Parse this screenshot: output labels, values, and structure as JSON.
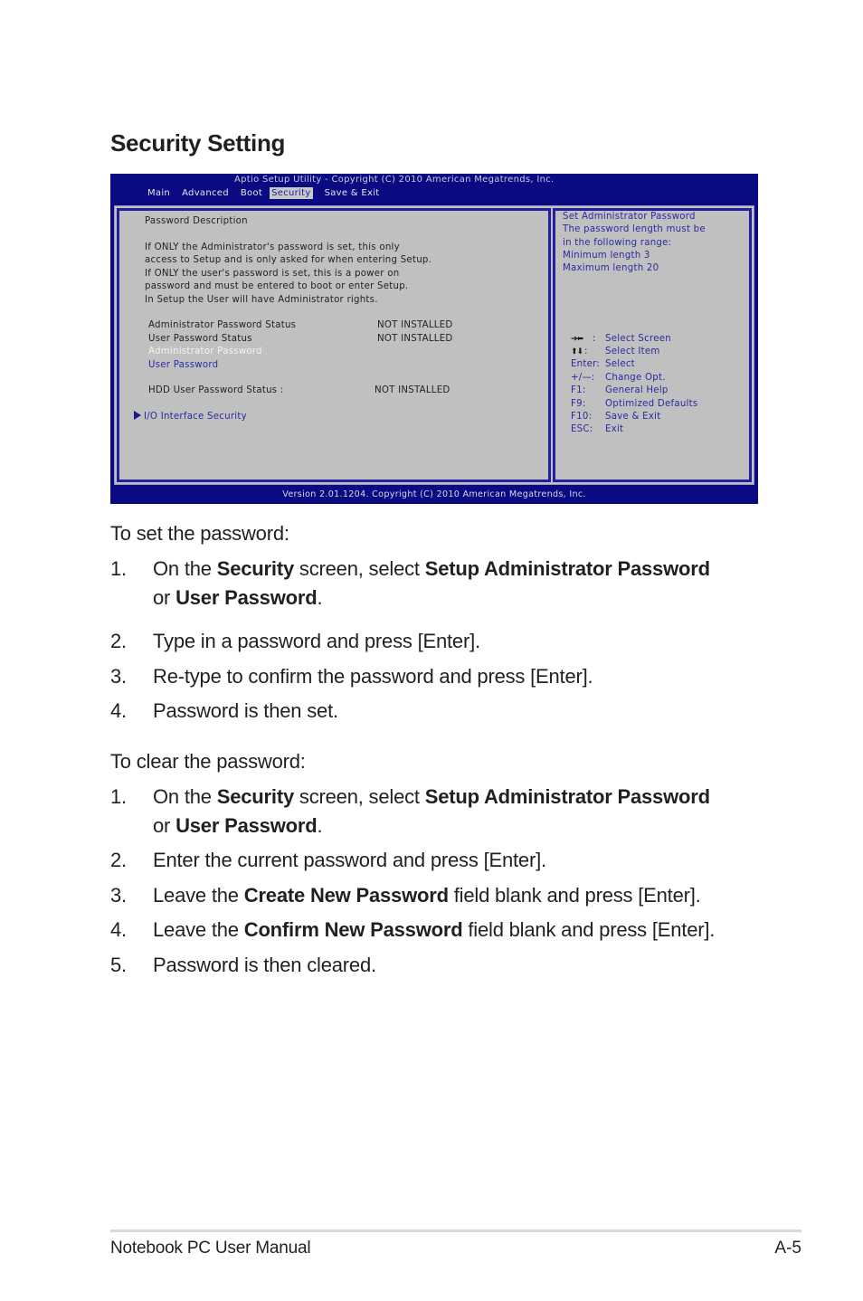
{
  "section_title": "Security Setting",
  "bios": {
    "title": "Aptio Setup Utility - Copyright (C) 2010 American Megatrends, Inc.",
    "tabs": [
      {
        "label": "Main",
        "active": false
      },
      {
        "label": "Advanced",
        "active": false
      },
      {
        "label": "Boot",
        "active": false
      },
      {
        "label": "Security",
        "active": true
      },
      {
        "label": "Save & Exit",
        "active": false
      }
    ],
    "description_heading": "Password Description",
    "description_lines": [
      "If ONLY the Administrator's password is set, this only",
      "access to Setup and is only asked for when entering Setup.",
      "If ONLY the user's password is set, this is a power on",
      "password and must be entered to boot or enter Setup.",
      "In Setup the User will have Administrator rights."
    ],
    "status_rows": [
      {
        "label": "Administrator Password Status",
        "value": "NOT INSTALLED"
      },
      {
        "label": "User Password Status",
        "value": "NOT INSTALLED"
      }
    ],
    "menu_items": [
      {
        "label": "Administrator Password",
        "selected": true
      },
      {
        "label": "User Password",
        "selected": false
      }
    ],
    "hdd_status": {
      "label": "HDD User Password Status  :",
      "value": "NOT INSTALLED"
    },
    "submenu": {
      "label": "I/O Interface Security",
      "icon": "triangle-right-icon"
    },
    "help_lines": [
      "Set Administrator Password",
      "The password length must be",
      "in the following range:",
      "Minimum length   3",
      "Maximum length   20"
    ],
    "keys": [
      {
        "key": "→←:",
        "icon": "left-right-arrows-icon",
        "action": "Select Screen"
      },
      {
        "key": "↑↓:",
        "icon": "up-down-arrows-icon",
        "action": "Select Item"
      },
      {
        "key": "Enter:",
        "action": "Select"
      },
      {
        "key": "+/—:",
        "action": "Change Opt."
      },
      {
        "key": "F1:",
        "action": "General Help"
      },
      {
        "key": "F9:",
        "action": "Optimized Defaults"
      },
      {
        "key": "F10:",
        "action": "Save & Exit"
      },
      {
        "key": "ESC:",
        "action": "Exit"
      }
    ],
    "footer": "Version 2.01.1204. Copyright (C) 2010 American Megatrends, Inc.",
    "colors": {
      "background": "#0a0a82",
      "panel": "#c0c0c0",
      "highlight_text": "#2a2aa0",
      "selected_text": "#f4f4f4"
    }
  },
  "set_password": {
    "intro": "To set the password:",
    "steps": [
      {
        "num": "1.",
        "parts": [
          "On the ",
          "Security",
          " screen, select ",
          "Setup Administrator Password"
        ],
        "parts2": [
          "or ",
          "User Password",
          "."
        ]
      },
      {
        "num": "2.",
        "text": "Type in a password and press [Enter]."
      },
      {
        "num": "3.",
        "text": "Re-type to confirm the password and press [Enter]."
      },
      {
        "num": "4.",
        "text": "Password is then set."
      }
    ]
  },
  "clear_password": {
    "intro": "To clear the password:",
    "steps": [
      {
        "num": "1.",
        "parts": [
          "On the ",
          "Security",
          " screen, select ",
          "Setup Administrator Password"
        ],
        "parts2": [
          "or ",
          "User Password",
          "."
        ]
      },
      {
        "num": "2.",
        "text": "Enter the current password and press [Enter]."
      },
      {
        "num": "3.",
        "parts": [
          "Leave the ",
          "Create New Password",
          " field blank and press [Enter]."
        ]
      },
      {
        "num": "4.",
        "parts": [
          "Leave the ",
          "Confirm New Password",
          " field blank and press [Enter]."
        ]
      },
      {
        "num": "5.",
        "text": "Password is then cleared."
      }
    ]
  },
  "footer": {
    "left": "Notebook PC User Manual",
    "right": "A-5"
  }
}
